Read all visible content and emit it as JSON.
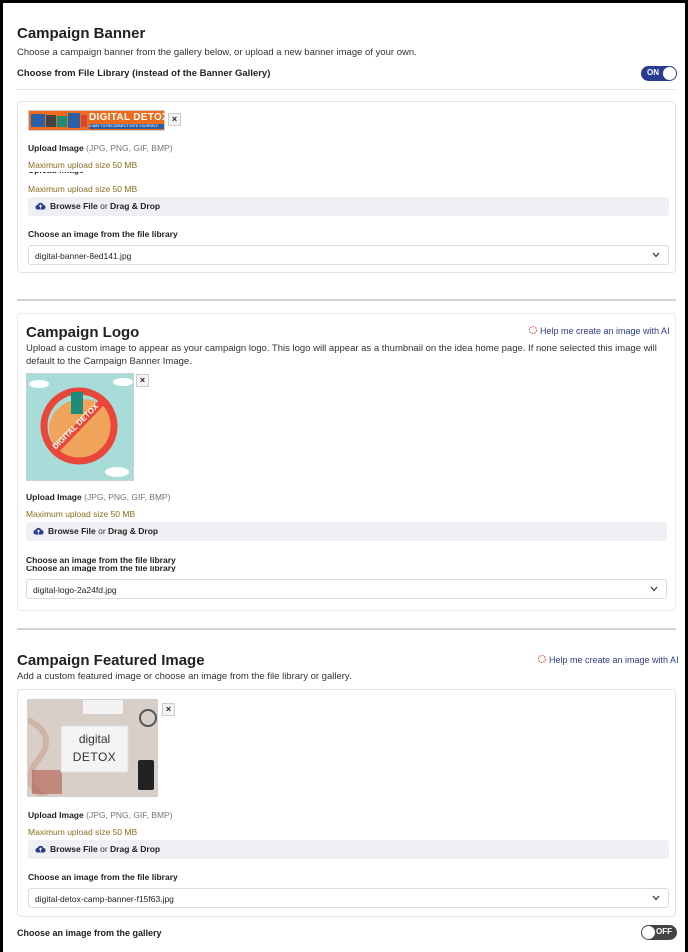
{
  "banner": {
    "title": "Campaign Banner",
    "description": "Choose a campaign banner from the gallery below, or upload a new banner image of your own.",
    "file_library_toggle_label": "Choose from File Library (instead of the Banner Gallery)",
    "toggle_state": "ON",
    "image_text_main": "DIGITAL DETOX",
    "image_text_sub": "A WAY TO RECONNECT WITH YOURSELF",
    "upload_label": "Upload Image",
    "upload_formats": "(JPG, PNG, GIF, BMP)",
    "max_size": "Maximum upload size 50 MB",
    "max_size_2": "Maximum upload size 50 MB",
    "browse_file": "Browse File",
    "browse_or": "or",
    "drag_drop": "Drag & Drop",
    "library_label": "Choose an image from the file library",
    "library_value": "digital-banner-8ed141.jpg"
  },
  "logo": {
    "title": "Campaign Logo",
    "ai_link": "Help me create an image with AI",
    "description": "Upload a custom image to appear as your campaign logo. This logo will appear as a thumbnail on the idea home page. If none selected this image will default to the Campaign Banner Image.",
    "image_text": "DIGITAL DETOX",
    "upload_label": "Upload Image",
    "upload_formats": "(JPG, PNG, GIF, BMP)",
    "max_size": "Maximum upload size 50 MB",
    "browse_file": "Browse File",
    "browse_or": "or",
    "drag_drop": "Drag & Drop",
    "library_label": "Choose an image from the file library",
    "library_value": "digital-logo-2a24fd.jpg"
  },
  "featured": {
    "title": "Campaign Featured Image",
    "ai_link": "Help me create an image with AI",
    "description": "Add a custom featured image or choose an image from the file library or gallery.",
    "image_line1": "digital",
    "image_line2": "DETOX",
    "upload_label": "Upload Image",
    "upload_formats": "(JPG, PNG, GIF, BMP)",
    "max_size": "Maximum upload size 50 MB",
    "browse_file": "Browse File",
    "browse_or": "or",
    "drag_drop": "Drag & Drop",
    "library_label": "Choose an image from the file library",
    "library_value": "digital-detox-camp-banner-f15f63.jpg",
    "gallery_label": "Choose an image from the gallery",
    "gallery_toggle_state": "OFF"
  },
  "colors": {
    "accent": "#2a3c8f",
    "max_size_text": "#8a6d1e",
    "banner_orange": "#ee6a1c"
  }
}
